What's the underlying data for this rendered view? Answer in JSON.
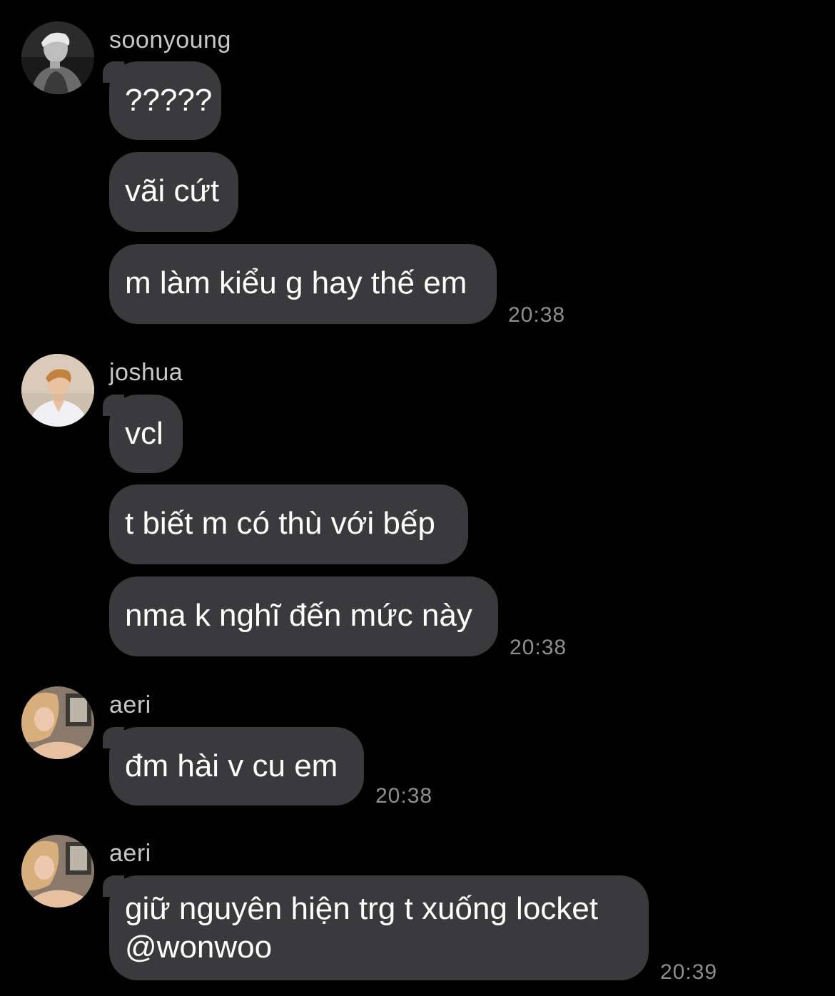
{
  "groups": [
    {
      "sender": "soonyoung",
      "avatar_icon": "avatar-soonyoung-photo-icon",
      "messages": [
        "?????",
        "vãi cứt",
        "m làm kiểu g hay thế em"
      ],
      "time": "20:38"
    },
    {
      "sender": "joshua",
      "avatar_icon": "avatar-joshua-photo-icon",
      "messages": [
        "vcl",
        "t biết m có thù với bếp",
        "nma k nghĩ đến mức này"
      ],
      "time": "20:38"
    },
    {
      "sender": "aeri",
      "avatar_icon": "avatar-aeri-photo-icon",
      "messages": [
        "đm hài v cu em"
      ],
      "time": "20:38"
    },
    {
      "sender": "aeri",
      "avatar_icon": "avatar-aeri-photo-icon",
      "messages": [
        "giữ nguyên hiện trg t xuống locket",
        "@wonwoo"
      ],
      "time": "20:39"
    }
  ],
  "colors": {
    "background": "#000000",
    "bubble": "#3a3a3c",
    "message_text": "#ffffff",
    "sender_text": "#c8c8c8",
    "time_text": "#8e8e93"
  }
}
